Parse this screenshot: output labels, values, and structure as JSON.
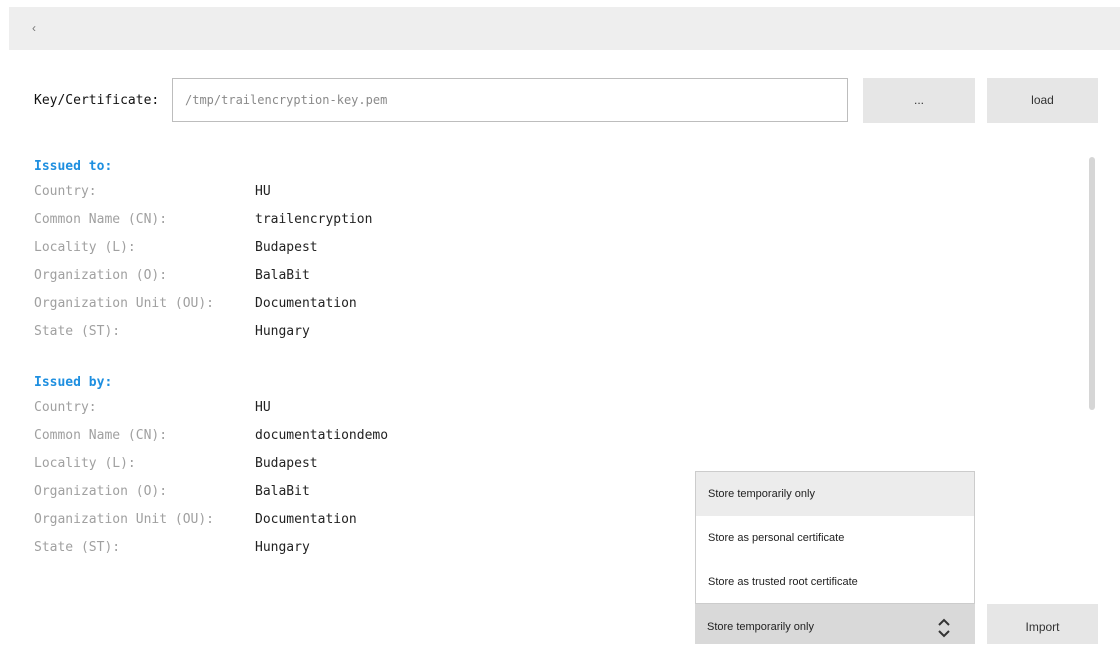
{
  "topbar": {
    "back_label": "‹"
  },
  "key": {
    "label": "Key/Certificate:",
    "value": "/tmp/trailencryption-key.pem",
    "browse_label": "...",
    "load_label": "load"
  },
  "issued_to": {
    "title": "Issued to:",
    "rows": [
      {
        "key": "Country:",
        "value": "HU"
      },
      {
        "key": "Common Name (CN):",
        "value": "trailencryption"
      },
      {
        "key": "Locality (L):",
        "value": "Budapest"
      },
      {
        "key": "Organization (O):",
        "value": "BalaBit"
      },
      {
        "key": "Organization Unit (OU):",
        "value": "Documentation"
      },
      {
        "key": "State (ST):",
        "value": "Hungary"
      }
    ]
  },
  "issued_by": {
    "title": "Issued by:",
    "rows": [
      {
        "key": "Country:",
        "value": "HU"
      },
      {
        "key": "Common Name (CN):",
        "value": "documentationdemo"
      },
      {
        "key": "Locality (L):",
        "value": "Budapest"
      },
      {
        "key": "Organization (O):",
        "value": "BalaBit"
      },
      {
        "key": "Organization Unit (OU):",
        "value": "Documentation"
      },
      {
        "key": "State (ST):",
        "value": "Hungary"
      }
    ]
  },
  "store": {
    "options": [
      "Store temporarily only",
      "Store as personal certificate",
      "Store as trusted root certificate"
    ],
    "selected": "Store temporarily only",
    "import_label": "Import"
  },
  "colors": {
    "section_title": "#1e8fe0",
    "topbar_bg": "#eeeeee",
    "button_bg": "#e6e6e6"
  },
  "icons": {
    "back": "chevron-left-icon",
    "select": "chevron-updown-icon"
  }
}
